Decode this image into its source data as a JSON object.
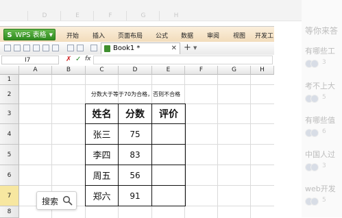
{
  "top_strip": {
    "faded_columns": [
      "D",
      "E",
      "F",
      "G",
      "H"
    ]
  },
  "app": {
    "wps_button_label": "WPS 表格",
    "wps_logo_glyph": "S",
    "ribbon_tabs": [
      "开始",
      "插入",
      "页面布局",
      "公式",
      "数据",
      "审阅",
      "视图",
      "开发工"
    ],
    "workbook_tab": "Book1 *",
    "name_box": "I7",
    "fx_label": "fx"
  },
  "grid": {
    "columns": [
      "A",
      "B",
      "C",
      "D",
      "E",
      "F",
      "G",
      "H"
    ],
    "rows": [
      "1",
      "2",
      "3",
      "4",
      "5",
      "6",
      "7",
      "8"
    ],
    "selected_row": "7"
  },
  "table": {
    "note": "分数大于等于70为合格，否则不合格",
    "headers": [
      "姓名",
      "分数",
      "评价"
    ],
    "rows": [
      {
        "name": "张三",
        "score": "75",
        "eval": ""
      },
      {
        "name": "李四",
        "score": "83",
        "eval": ""
      },
      {
        "name": "周五",
        "score": "56",
        "eval": ""
      },
      {
        "name": "郑六",
        "score": "91",
        "eval": ""
      }
    ]
  },
  "search": {
    "label": "搜索",
    "icon": "magnifier-icon"
  },
  "right_panel": {
    "items": [
      {
        "text": "等你来答"
      },
      {
        "text": "有哪些工",
        "count": "3"
      },
      {
        "text": "考不上大",
        "count": "5"
      },
      {
        "text": "有哪些值",
        "count": "6"
      },
      {
        "text": "中国人过",
        "count": "3"
      },
      {
        "text": "web开发",
        "count": "5"
      }
    ]
  },
  "colors": {
    "wps_green": "#3f9a2c",
    "ribbon": "#f2dcbb",
    "selected_row": "#f7e7a0"
  }
}
